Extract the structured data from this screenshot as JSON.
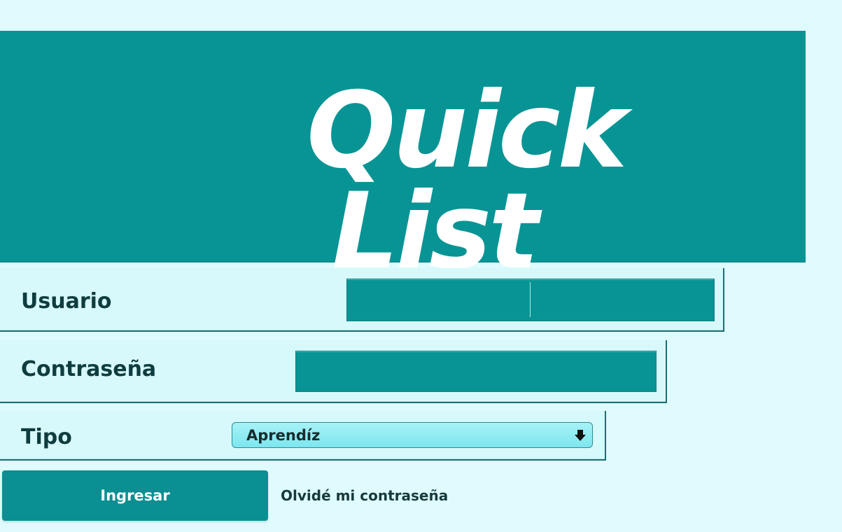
{
  "brand": {
    "line1": "Quick",
    "line2": "List"
  },
  "form": {
    "user_label": "Usuario",
    "user_value": "",
    "password_label": "Contraseña",
    "password_value": "",
    "type_label": "Tipo",
    "type_selected": "Aprendíz",
    "submit_label": "Ingresar",
    "forgot_link": "Olvidé mi contraseña"
  },
  "icons": {
    "select_arrow": "down-arrow-icon"
  },
  "colors": {
    "page_bg": "#dffbfd",
    "primary": "#089494",
    "text_dark": "#0f3d3f",
    "select_bg": "#7de6ef"
  }
}
